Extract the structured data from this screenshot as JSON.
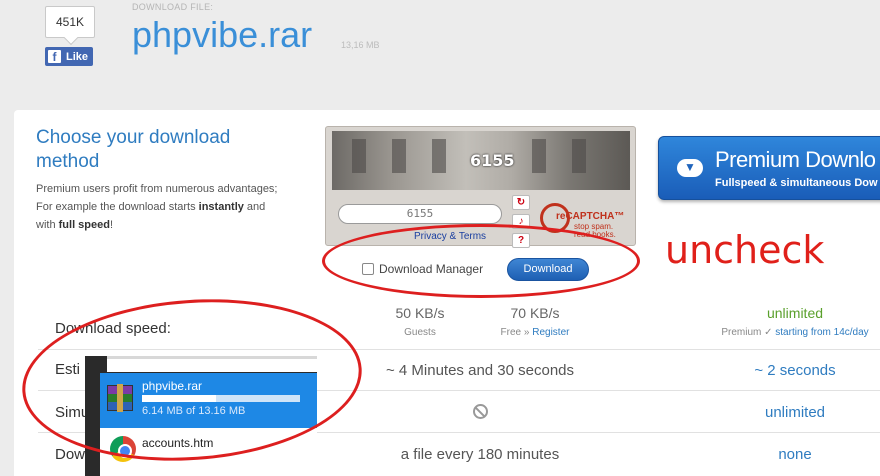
{
  "header": {
    "like_count": "451K",
    "like_label": "Like",
    "download_file_label": "DOWNLOAD FILE:",
    "file_name": "phpvibe.rar",
    "file_size": "13,16 MB"
  },
  "method": {
    "title": "Choose your download method",
    "desc_line1": "Premium users profit from numerous advantages;",
    "desc_line2_pre": "For example the download starts ",
    "desc_line2_bold": "instantly",
    "desc_line2_post": " and",
    "desc_line3_pre": "with ",
    "desc_line3_bold": "full speed",
    "desc_line3_post": "!"
  },
  "captcha": {
    "image_word": "6155",
    "input_value": "6155",
    "privacy_link": "Privacy & Terms",
    "brand": "reCAPTCHA™",
    "tagline_1": "stop spam.",
    "tagline_2": "read books."
  },
  "download_form": {
    "download_manager_label": "Download Manager",
    "download_manager_checked": false,
    "download_button": "Download"
  },
  "premium": {
    "title": "Premium Downlo",
    "subtitle": "Fullspeed & simultaneous Dow"
  },
  "annotation": {
    "note": "uncheck",
    "color": "#e0201a"
  },
  "table": {
    "speed_label": "Download speed:",
    "guests_speed": "50 KB/s",
    "guests_label": "Guests",
    "free_speed": "70 KB/s",
    "free_label": "Free",
    "free_sep": " » ",
    "register_link": "Register",
    "premium_speed": "unlimited",
    "premium_label": "Premium ✓ ",
    "premium_link": "starting from 14c/day",
    "est_label": "Esti",
    "est_free": "~ 4 Minutes and 30 seconds",
    "est_premium": "~ 2 seconds",
    "sim_label": "Simu",
    "sim_premium": "unlimited",
    "restr_label": "Download restr",
    "restr_free": "a file every 180 minutes",
    "restr_premium": "none"
  },
  "download_popup": {
    "item1_name": "phpvibe.rar",
    "item1_progress": "6.14 MB of 13.16 MB",
    "item1_fraction": 0.466,
    "item2_name": "accounts.htm"
  }
}
